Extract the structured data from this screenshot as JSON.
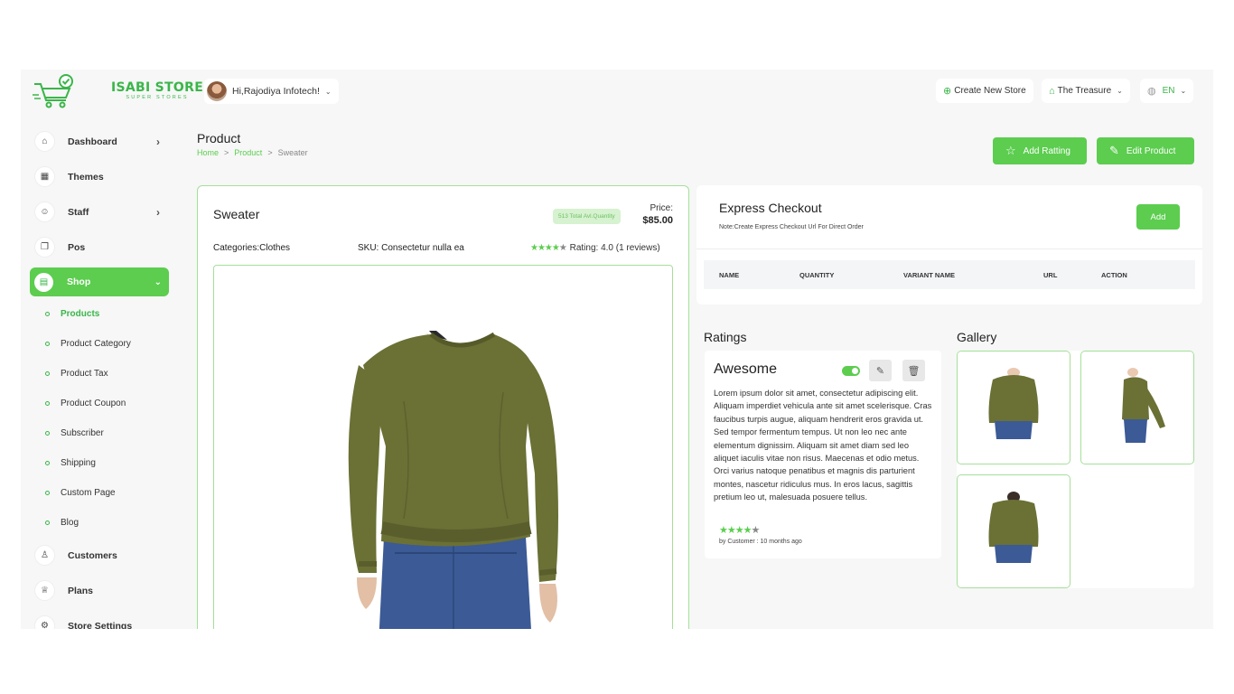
{
  "brand": {
    "title": "ISABI STORE",
    "subtitle": "SUPER STORES"
  },
  "user": {
    "greeting": "Hi,Rajodiya Infotech!"
  },
  "header": {
    "create_store": "Create New Store",
    "store_name": "The Treasure",
    "language": "EN"
  },
  "sidebar": {
    "items": [
      {
        "label": "Dashboard",
        "icon": "home-icon",
        "arrow": "›"
      },
      {
        "label": "Themes",
        "icon": "grid-icon"
      },
      {
        "label": "Staff",
        "icon": "users-icon",
        "arrow": "›"
      },
      {
        "label": "Pos",
        "icon": "copy-icon"
      },
      {
        "label": "Shop",
        "icon": "shop-icon",
        "arrow": "⌄"
      }
    ],
    "shop_sub": [
      "Products",
      "Product Category",
      "Product Tax",
      "Product Coupon",
      "Subscriber",
      "Shipping",
      "Custom Page",
      "Blog"
    ],
    "bottom": [
      {
        "label": "Customers",
        "icon": "user-icon"
      },
      {
        "label": "Plans",
        "icon": "trophy-icon"
      },
      {
        "label": "Store Settings",
        "icon": "gear-icon"
      }
    ]
  },
  "page": {
    "title": "Product",
    "breadcrumb": [
      "Home",
      "Product",
      "Sweater"
    ],
    "sep": ">",
    "add_rating": "Add Ratting",
    "edit_product": "Edit Product"
  },
  "product": {
    "name": "Sweater",
    "qty_badge": "513 Total Avl.Quantity",
    "price_label": "Price:",
    "price": "$85.00",
    "categories": "Categories:Clothes",
    "sku": "SKU: Consectetur nulla ea",
    "stars_on": "★★★★",
    "stars_off": "★",
    "rating_text": "Rating: 4.0 (1 reviews)"
  },
  "express": {
    "title": "Express Checkout",
    "note": "Note:Create Express Checkout Url For Direct Order",
    "add": "Add",
    "columns": [
      "NAME",
      "QUANTITY",
      "VARIANT NAME",
      "URL",
      "ACTION"
    ]
  },
  "ratings": {
    "title": "Ratings",
    "card_title": "Awesome",
    "enabled": true,
    "body": "Lorem ipsum dolor sit amet, consectetur adipiscing elit. Aliquam imperdiet vehicula ante sit amet scelerisque. Cras faucibus turpis augue, aliquam hendrerit eros gravida ut. Sed tempor fermentum tempus. Ut non leo nec ante elementum dignissim. Aliquam sit amet diam sed leo aliquet iaculis vitae non risus. Maecenas et odio metus. Orci varius natoque penatibus et magnis dis parturient montes, nascetur ridiculus mus. In eros lacus, sagittis pretium leo ut, malesuada posuere tellus.",
    "stars_on": "★★★★",
    "stars_off": "★",
    "by": "by Customer : 10 months ago"
  },
  "gallery": {
    "title": "Gallery"
  },
  "colors": {
    "accent": "#5ccd4f",
    "sweater": "#6b7035",
    "jeans": "#3b5a96"
  }
}
